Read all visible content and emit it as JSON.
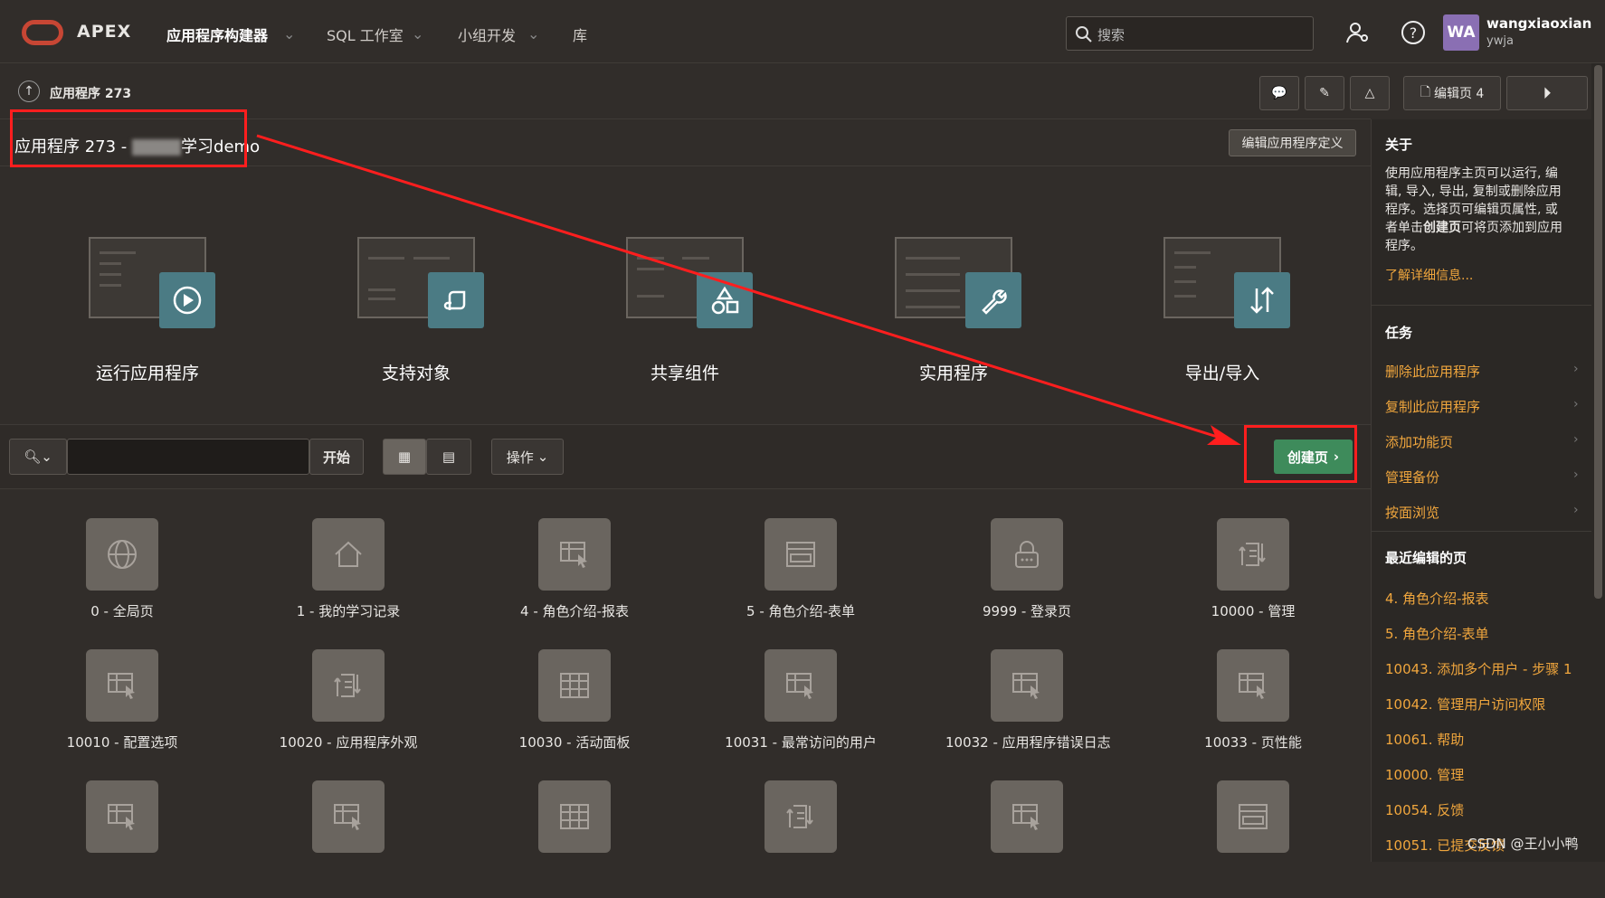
{
  "header": {
    "brand": "APEX",
    "nav": [
      "应用程序构建器",
      "SQL 工作室",
      "小组开发",
      "库"
    ],
    "search_placeholder": "搜索",
    "user_initials": "WA",
    "user_name": "wangxiaoxian",
    "workspace": "ywja"
  },
  "breadcrumb": {
    "label": "应用程序 273"
  },
  "toolbar": {
    "edit_page": "编辑页 4"
  },
  "app": {
    "title_prefix": "应用程序 273 - ",
    "title_suffix": "学习demo",
    "edit_definition": "编辑应用程序定义"
  },
  "tiles": [
    {
      "label": "运行应用程序"
    },
    {
      "label": "支持对象"
    },
    {
      "label": "共享组件"
    },
    {
      "label": "实用程序"
    },
    {
      "label": "导出/导入"
    }
  ],
  "filter": {
    "go": "开始",
    "actions": "操作",
    "create_page": "创建页"
  },
  "pages": [
    {
      "label": "0 - 全局页",
      "icon": "globe-icon"
    },
    {
      "label": "1 - 我的学习记录",
      "icon": "home-icon"
    },
    {
      "label": "4 - 角色介绍-报表",
      "icon": "report-icon"
    },
    {
      "label": "5 - 角色介绍-表单",
      "icon": "form-icon"
    },
    {
      "label": "9999 - 登录页",
      "icon": "lock-icon"
    },
    {
      "label": "10000 - 管理",
      "icon": "admin-icon"
    },
    {
      "label": "10010 - 配置选项",
      "icon": "report-icon"
    },
    {
      "label": "10020 - 应用程序外观",
      "icon": "admin-icon"
    },
    {
      "label": "10030 - 活动面板",
      "icon": "grid-icon"
    },
    {
      "label": "10031 - 最常访问的用户",
      "icon": "report-icon"
    },
    {
      "label": "10032 - 应用程序错误日志",
      "icon": "report-icon"
    },
    {
      "label": "10033 - 页性能",
      "icon": "report-icon"
    },
    {
      "label": "",
      "icon": "report-icon"
    },
    {
      "label": "",
      "icon": "report-icon"
    },
    {
      "label": "",
      "icon": "grid-icon"
    },
    {
      "label": "",
      "icon": "admin-icon"
    },
    {
      "label": "",
      "icon": "report-icon"
    },
    {
      "label": "",
      "icon": "form-icon"
    }
  ],
  "sidebar": {
    "about_title": "关于",
    "about_text_1": "使用应用程序主页可以运行, 编辑, 导入, 导出, 复制或删除应用程序。选择页可编辑页属性, 或者单击",
    "about_text_bold": "创建页",
    "about_text_2": "可将页添加到应用程序。",
    "learn_more": "了解详细信息...",
    "tasks_title": "任务",
    "tasks": [
      "删除此应用程序",
      "复制此应用程序",
      "添加功能页",
      "管理备份",
      "按面浏览"
    ],
    "recent_title": "最近编辑的页",
    "recent": [
      "4. 角色介绍-报表",
      "5. 角色介绍-表单",
      "10043. 添加多个用户 - 步骤 1",
      "10042. 管理用户访问权限",
      "10061. 帮助",
      "10000. 管理",
      "10054. 反馈",
      "10051. 已提交反馈"
    ]
  },
  "watermark": "CSDN @王小小鸭",
  "colors": {
    "accent": "#f0a63d",
    "create": "#3e8b5b",
    "badge": "#4b7b84",
    "annotation": "#ff1e1e"
  }
}
